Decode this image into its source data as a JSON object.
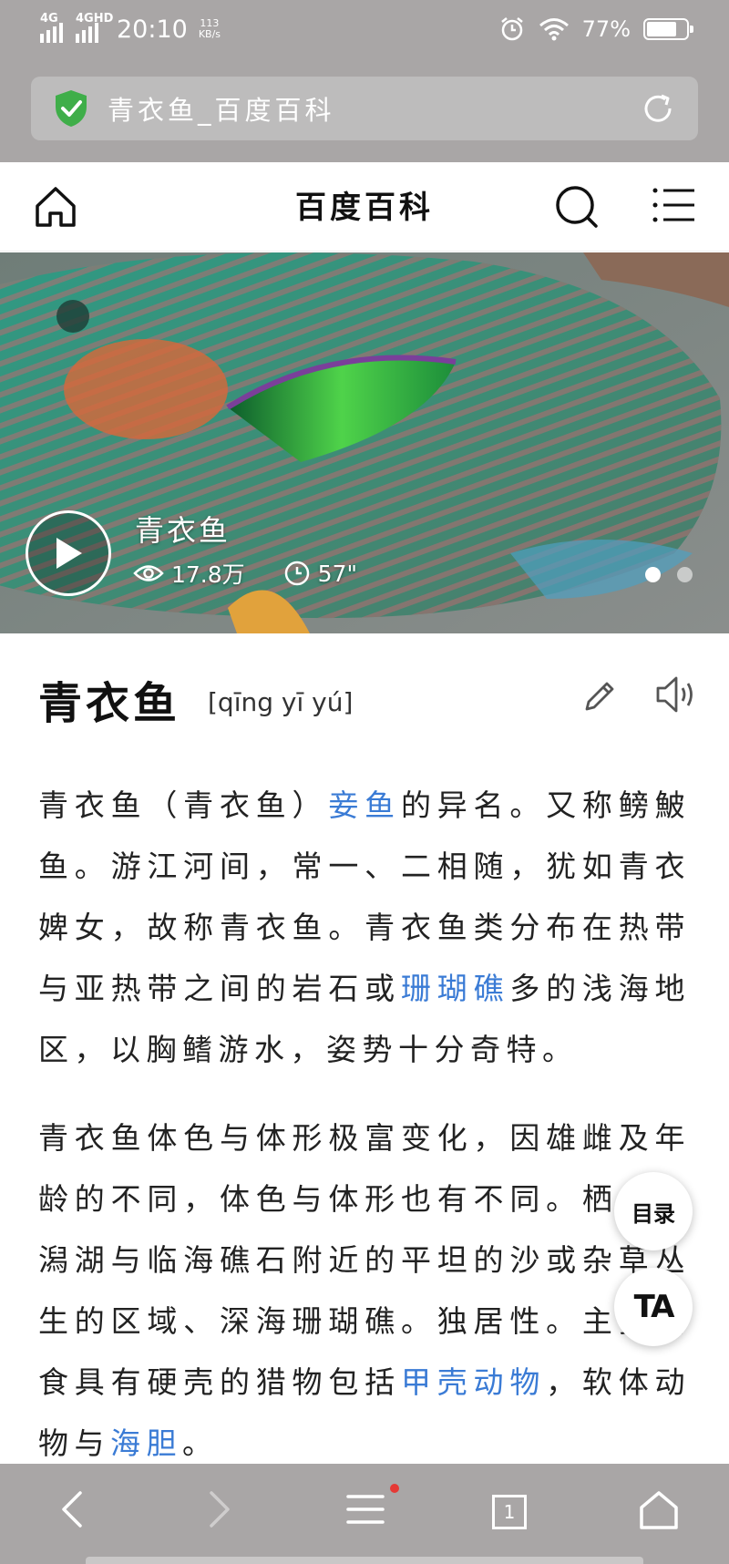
{
  "status_bar": {
    "network1": "4G",
    "network2": "4GHD",
    "time": "20:10",
    "speed_value": "113",
    "speed_unit": "KB/s",
    "battery": "77%",
    "battery_level": 0.77
  },
  "url_bar": {
    "title": "青衣鱼_百度百科"
  },
  "site_header": {
    "brand": "百度百科"
  },
  "video": {
    "title": "青衣鱼",
    "views": "17.8万",
    "duration": "57\"",
    "dots_total": 2,
    "dots_active": 1
  },
  "entry": {
    "title": "青衣鱼",
    "pinyin": "[qīng yī yú]"
  },
  "paragraph1": {
    "t1": "青衣鱼（青衣鱼）",
    "link1": "妾鱼",
    "t2": "的异名。又称鳑鮍鱼。游江河间，常一、二相随，犹如青衣婢女，故称青衣鱼。青衣鱼类分布在热带与亚热带之间的岩石或",
    "link2": "珊瑚礁",
    "t3": "多的浅海地区，以胸鳍游水，姿势十分奇特。"
  },
  "paragraph2": {
    "t1": "青衣鱼体色与体形极富变化，因雄雌及年龄的不同，体色与体形也有不同。栖息在潟湖与临海礁石附近的平坦的沙或杂草丛生的区域、深海珊瑚礁。独居性。主要捕食具有硬壳的猎物包括",
    "link1": "甲壳动物",
    "t2": "，软体动物与",
    "link2": "海胆",
    "t3": "。"
  },
  "floating": {
    "toc": "目录",
    "ta": "TA"
  },
  "bottom_nav": {
    "tab_count": "1"
  },
  "colors": {
    "chrome_gray": "#a9a6a6",
    "link_blue": "#3a7bd5",
    "shield_green": "#3fae49",
    "notification_red": "#e53935"
  }
}
